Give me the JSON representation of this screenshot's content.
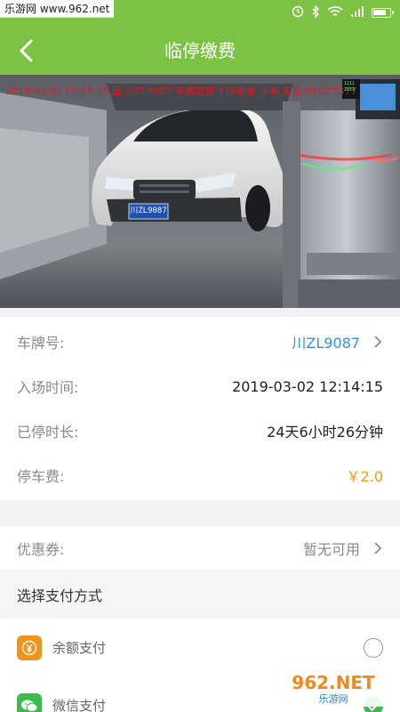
{
  "statusbar": {
    "watermark": "乐游网 www.962.net",
    "icons": [
      "alarm-icon",
      "bluetooth-icon",
      "wifi-icon",
      "signal-icon",
      "battery-icon"
    ]
  },
  "header": {
    "title": "临停缴费"
  },
  "photo": {
    "stamp": "2019-03-02 12:14:15 蓝 川ZL9087 车牌宽度:159像素 小车 车身:0X6C7377",
    "plate_text": "川ZL9087",
    "screen_text": "1211\n2019"
  },
  "details": {
    "plate_label": "车牌号:",
    "plate_value": "川ZL9087",
    "entry_label": "入场时间:",
    "entry_value": "2019-03-02 12:14:15",
    "duration_label": "已停时长:",
    "duration_value": "24天6小时26分钟",
    "fee_label": "停车费:",
    "fee_value": "￥2.0"
  },
  "coupon": {
    "label": "优惠券:",
    "value": "暂无可用"
  },
  "payment": {
    "heading": "选择支付方式",
    "methods": [
      {
        "label": "余额支付",
        "icon": "wallet-yen-icon",
        "icon_glyph": "¥",
        "color": "#f0941e",
        "selected": false
      },
      {
        "label": "微信支付",
        "icon": "wechat-icon",
        "icon_glyph": "",
        "color": "#3dba4e",
        "selected": true
      }
    ]
  },
  "site_logo": {
    "main": "962.NET",
    "sub": "乐游网"
  },
  "colors": {
    "brand": "#7cc243",
    "link": "#3a8ee6",
    "fee": "#f39c12"
  }
}
